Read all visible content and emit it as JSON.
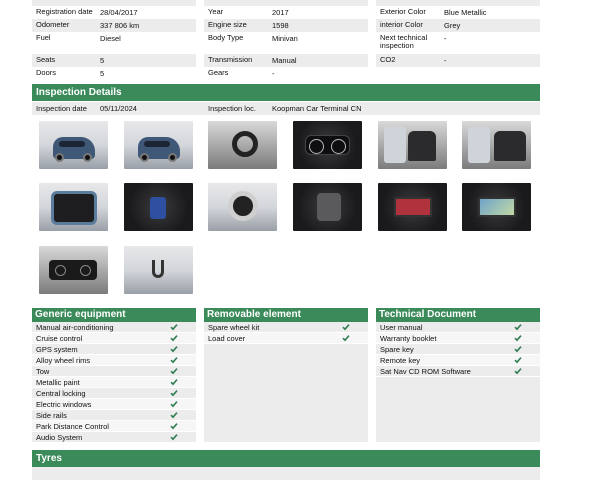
{
  "spec": {
    "col1": [
      {
        "label": "Registration date",
        "value": "28/04/2017"
      },
      {
        "label": "Odometer",
        "value": "337 806 km"
      },
      {
        "label": "Fuel",
        "value": "Diesel"
      },
      {
        "label": "Seats",
        "value": "5"
      },
      {
        "label": "Doors",
        "value": "5"
      }
    ],
    "col2": [
      {
        "label": "Year",
        "value": "2017"
      },
      {
        "label": "Engine size",
        "value": "1598"
      },
      {
        "label": "Body Type",
        "value": "Minivan"
      },
      {
        "label": "Transmission",
        "value": "Manual"
      },
      {
        "label": "Gears",
        "value": "-"
      }
    ],
    "col3": [
      {
        "label": "Exterior Color",
        "value": "Blue Metallic"
      },
      {
        "label": "interior Color",
        "value": "Grey"
      },
      {
        "label": "Next technical inspection",
        "value": "-"
      },
      {
        "label": "CO2",
        "value": "-"
      }
    ]
  },
  "inspection": {
    "title": "Inspection Details",
    "date_label": "Inspection date",
    "date_value": "05/11/2024",
    "loc_label": "Inspection loc.",
    "loc_value": "Koopman Car Terminal CN"
  },
  "photo_icons": [
    "car-front-photo",
    "car-rear-photo",
    "steering-wheel-photo",
    "instrument-cluster-photo",
    "front-seat-photo",
    "rear-seat-photo",
    "trunk-photo",
    "spare-tools-photo",
    "wheel-photo",
    "gear-shift-photo",
    "radio-screen-photo",
    "navigation-screen-photo",
    "climate-panel-photo",
    "tow-hook-photo"
  ],
  "generic": {
    "title": "Generic equipment",
    "items": [
      "Manual air-conditioning",
      "Cruise control",
      "GPS system",
      "Alloy wheel rims",
      "Tow",
      "Metallic paint",
      "Central locking",
      "Electric windows",
      "Side rails",
      "Park Distance Control",
      "Audio System"
    ]
  },
  "removable": {
    "title": "Removable element",
    "items": [
      "Spare wheel kit",
      "Load cover"
    ]
  },
  "technical": {
    "title": "Technical Document",
    "items": [
      "User manual",
      "Warranty booklet",
      "Spare key",
      "Remote key",
      "Sat Nav CD ROM Software"
    ]
  },
  "tyres": {
    "title": "Tyres"
  },
  "colors": {
    "accent": "#3a8a5a",
    "check": "#2e7d4f",
    "row_shade": "#ececec"
  }
}
